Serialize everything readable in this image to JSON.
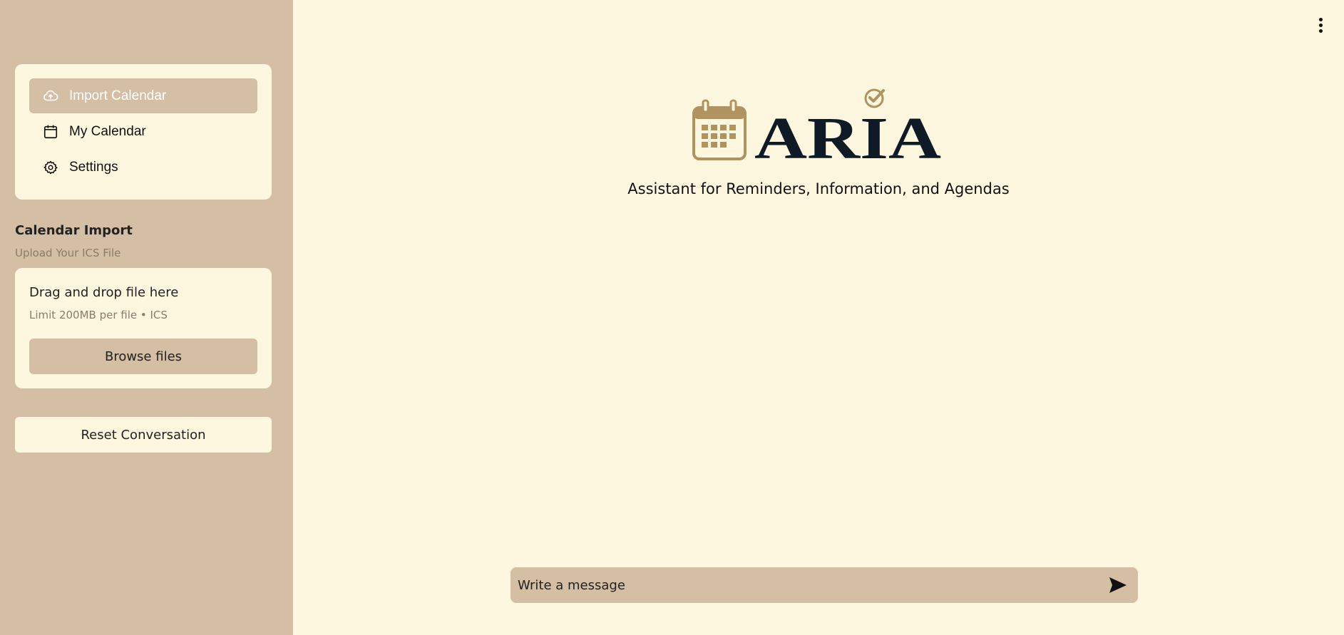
{
  "sidebar": {
    "nav": [
      {
        "label": "Import Calendar",
        "icon": "cloud-upload-icon",
        "active": true
      },
      {
        "label": "My Calendar",
        "icon": "calendar-icon",
        "active": false
      },
      {
        "label": "Settings",
        "icon": "gear-icon",
        "active": false
      }
    ],
    "section_title": "Calendar Import",
    "section_subtitle": "Upload Your ICS File",
    "uploader": {
      "title": "Drag and drop file here",
      "limit": "Limit 200MB per file • ICS",
      "browse_label": "Browse files"
    },
    "reset_label": "Reset Conversation"
  },
  "main": {
    "logo_text": "ARIA",
    "tagline": "Assistant for Reminders, Information, and Agendas",
    "chat": {
      "placeholder": "Write a message"
    }
  },
  "colors": {
    "sidebar_bg": "#D4BEA4",
    "main_bg": "#FDF7DF",
    "logo_dark": "#0E1B26",
    "logo_gold": "#B0935F"
  }
}
